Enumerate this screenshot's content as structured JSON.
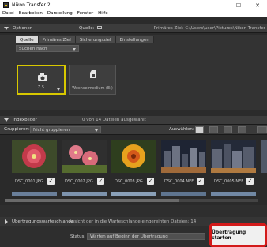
{
  "window": {
    "title": "Nikon Transfer 2",
    "minimize": "–",
    "maximize": "☐",
    "close": "✕"
  },
  "menu": [
    "Datei",
    "Bearbeiten",
    "Darstellung",
    "Fenster",
    "Hilfe"
  ],
  "options": {
    "header_label": "Optionen",
    "source_label": "Quelle:",
    "dest_label": "Primäres Ziel: C:\\Users\\user\\Pictures\\Nikon Transfer",
    "tabs": [
      "Quelle",
      "Primäres Ziel",
      "Sicherungsziel",
      "Einstellungen"
    ],
    "active_tab": 0,
    "search_label": "Suchen nach",
    "source_cards": [
      {
        "label": "Z 5",
        "selected": true
      },
      {
        "label": "Wechselmedium (E:)",
        "selected": false
      }
    ]
  },
  "thumbnails": {
    "header_label": "Indexbilder",
    "selection_info": "0 von 14 Dateien ausgewählt",
    "group_label": "Gruppieren:",
    "group_value": "Nicht gruppieren",
    "select_label": "Auswählen:",
    "items": [
      {
        "name": "DSC_0001.JPG",
        "checked": true
      },
      {
        "name": "DSC_0002.JPG",
        "checked": true
      },
      {
        "name": "DSC_0003.JPG",
        "checked": true
      },
      {
        "name": "DSC_0004.NEF",
        "checked": true
      },
      {
        "name": "DSC_0005.NEF",
        "checked": true
      }
    ]
  },
  "queue": {
    "header_label": "Übertragungswarteschlange",
    "info": "Ansicht der in die Warteschlange eingereihten Dateien: 14"
  },
  "status": {
    "label": "Status:",
    "value": "Warten auf Beginn der Übertragung"
  },
  "start_button": "Übertragung starten"
}
